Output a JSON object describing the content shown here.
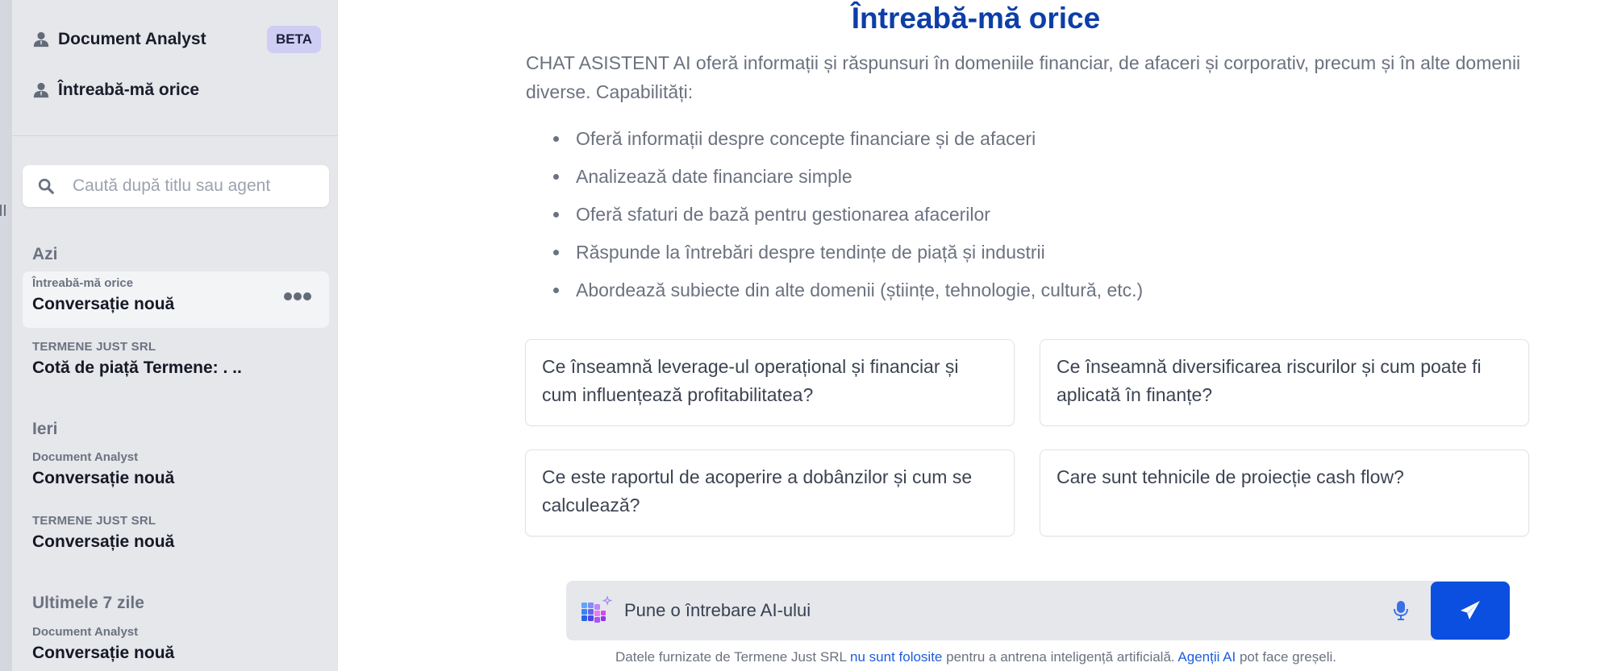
{
  "sidebar": {
    "agents": [
      {
        "label": "Document Analyst",
        "badge": "BETA",
        "icon": "person-icon"
      },
      {
        "label": "Întreabă-mă orice",
        "icon": "person-icon"
      }
    ],
    "search": {
      "placeholder": "Caută după titlu sau agent",
      "value": ""
    },
    "sections": [
      {
        "title": "Azi",
        "conversations": [
          {
            "agent": "Întreabă-mă orice",
            "title": "Conversație nouă",
            "active": true
          },
          {
            "agent": "TERMENE JUST SRL",
            "title": "Cotă de piață Termene: . ..",
            "active": false
          }
        ]
      },
      {
        "title": "Ieri",
        "conversations": [
          {
            "agent": "Document Analyst",
            "title": "Conversație nouă",
            "active": false
          },
          {
            "agent": "TERMENE JUST SRL",
            "title": "Conversație nouă",
            "active": false
          }
        ]
      },
      {
        "title": "Ultimele 7 zile",
        "conversations": [
          {
            "agent": "Document Analyst",
            "title": "Conversație nouă",
            "active": false
          }
        ]
      }
    ]
  },
  "main": {
    "title": "Întreabă-mă orice",
    "intro": "CHAT ASISTENT AI oferă informații și răspunsuri în domeniile financiar, de afaceri și corporativ, precum și în alte domenii diverse. Capabilități:",
    "capabilities": [
      "Oferă informații despre concepte financiare și de afaceri",
      "Analizează date financiare simple",
      "Oferă sfaturi de bază pentru gestionarea afacerilor",
      "Răspunde la întrebări despre tendințe de piață și industrii",
      "Abordează subiecte din alte domenii (științe, tehnologie, cultură, etc.)"
    ],
    "suggestions": [
      "Ce înseamnă leverage-ul operațional și financiar și cum influențează profitabilitatea?",
      "Ce înseamnă diversificarea riscurilor și cum poate fi aplicată în finanțe?",
      "Ce este raportul de acoperire a dobânzilor și cum se calculează?",
      "Care sunt tehnicile de proiecție cash flow?"
    ],
    "composer": {
      "placeholder": "Pune o întrebare AI-ului",
      "value": "",
      "mic_icon": "microphone-icon",
      "send_icon": "paper-plane-icon"
    },
    "footnote": {
      "part1": "Datele furnizate de Termene Just SRL ",
      "link1": "nu sunt folosite",
      "part2": " pentru a antrena inteligență artificială. ",
      "link2": "Agenții AI",
      "part3": " pot face greșeli."
    }
  },
  "colors": {
    "title": "#0d3ea8",
    "send_button": "#0b4fe0",
    "link": "#1d5ce0",
    "beta_badge": "#cfcdf4",
    "sidebar_bg": "#e6e7eb"
  }
}
